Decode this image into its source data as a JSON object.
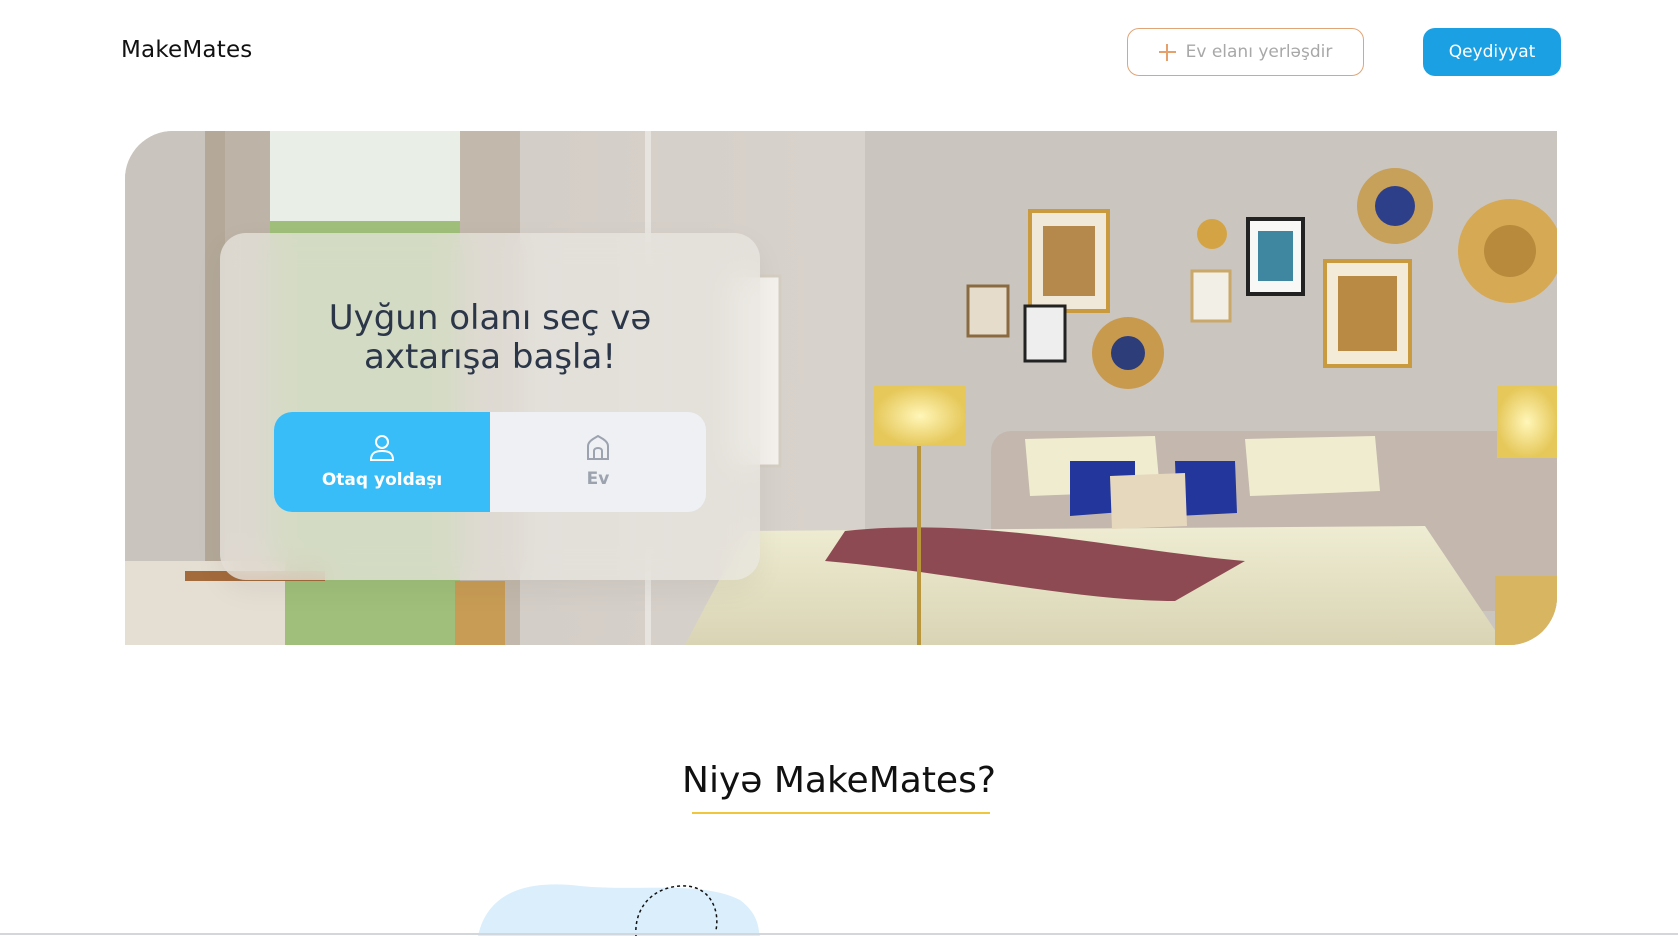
{
  "header": {
    "logo": "MakeMates",
    "post_button_label": "Ev elanı yerləşdir",
    "register_button_label": "Qeydiyyat"
  },
  "hero": {
    "title": "Uyğun olanı seç və\naxtarışa başla!",
    "options": [
      {
        "label": "Otaq yoldaşı",
        "icon": "user-icon",
        "selected": true
      },
      {
        "label": "Ev",
        "icon": "home-icon",
        "selected": false
      }
    ]
  },
  "section": {
    "title": "Niyə MakeMates?"
  },
  "colors": {
    "primary": "#1ba1e3",
    "toggle_active": "#38bdf8",
    "accent_outline": "#e0a577",
    "underline": "#f0c63c"
  }
}
